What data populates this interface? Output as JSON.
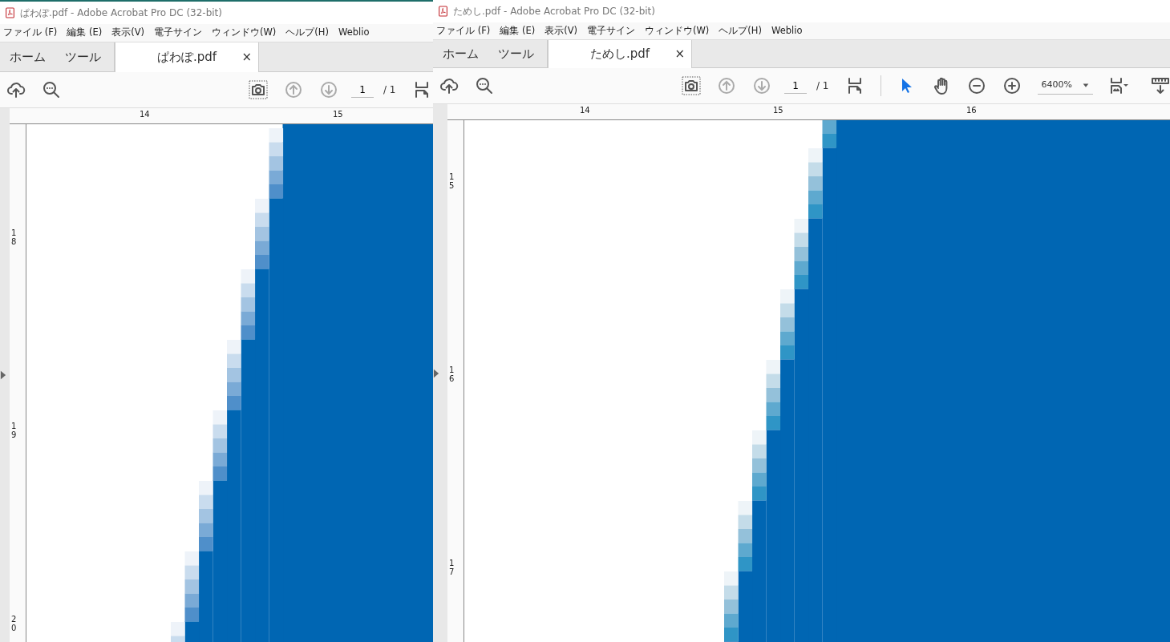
{
  "windows": [
    {
      "title": "ぱわぽ.pdf - Adobe Acrobat Pro DC (32-bit)",
      "focused": true,
      "menu": [
        "ファイル (F)",
        "編集 (E)",
        "表示(V)",
        "電子サイン",
        "ウィンドウ(W)",
        "ヘルプ(H)",
        "Weblio"
      ],
      "tabs": [
        {
          "label": "ホーム",
          "selected": false
        },
        {
          "label": "ツール",
          "selected": false
        },
        {
          "label": "ぱわぽ.pdf",
          "selected": true,
          "close": "×"
        }
      ],
      "toolbar": {
        "prev_disabled": true,
        "next_disabled": true,
        "page": "1",
        "page_total": "/ 1"
      },
      "ruler_h": [
        "14",
        "15"
      ],
      "ruler_v": [
        "18",
        "19",
        "20"
      ]
    },
    {
      "title": "ためし.pdf - Adobe Acrobat Pro DC (32-bit)",
      "focused": false,
      "menu": [
        "ファイル (F)",
        "編集 (E)",
        "表示(V)",
        "電子サイン",
        "ウィンドウ(W)",
        "ヘルプ(H)",
        "Weblio"
      ],
      "tabs": [
        {
          "label": "ホーム",
          "selected": false
        },
        {
          "label": "ツール",
          "selected": false
        },
        {
          "label": "ためし.pdf",
          "selected": true,
          "close": "×"
        }
      ],
      "toolbar": {
        "prev_disabled": true,
        "next_disabled": true,
        "page": "1",
        "page_total": "/ 1",
        "zoom": "6400%"
      },
      "ruler_h": [
        "14",
        "15",
        "16"
      ],
      "ruler_v": [
        "15",
        "16",
        "17"
      ]
    }
  ]
}
